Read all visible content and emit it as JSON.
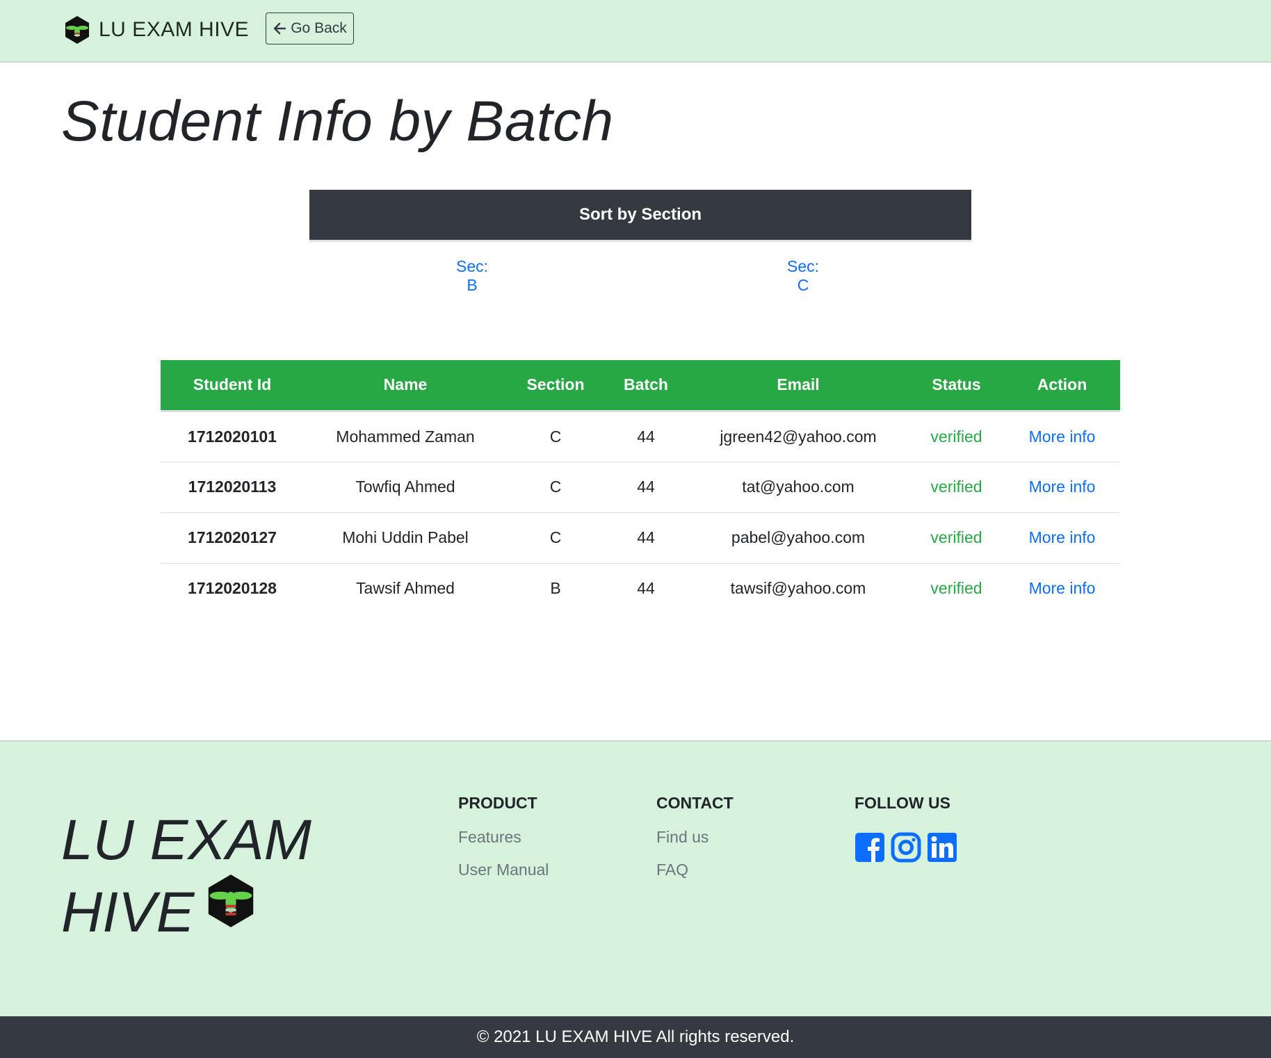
{
  "navbar": {
    "brand": "LU EXAM HIVE",
    "go_back_label": "Go Back"
  },
  "page_title": "Student Info by Batch",
  "sort": {
    "header": "Sort by Section",
    "sections": [
      "Sec: B",
      "Sec: C"
    ]
  },
  "table": {
    "columns": [
      "Student Id",
      "Name",
      "Section",
      "Batch",
      "Email",
      "Status",
      "Action"
    ],
    "rows": [
      {
        "id": "1712020101",
        "name": "Mohammed Zaman",
        "section": "C",
        "batch": "44",
        "email": "jgreen42@yahoo.com",
        "status": "verified",
        "action": "More info"
      },
      {
        "id": "1712020113",
        "name": "Towfiq Ahmed",
        "section": "C",
        "batch": "44",
        "email": "tat@yahoo.com",
        "status": "verified",
        "action": "More info"
      },
      {
        "id": "1712020127",
        "name": "Mohi Uddin Pabel",
        "section": "C",
        "batch": "44",
        "email": "pabel@yahoo.com",
        "status": "verified",
        "action": "More info"
      },
      {
        "id": "1712020128",
        "name": "Tawsif Ahmed",
        "section": "B",
        "batch": "44",
        "email": "tawsif@yahoo.com",
        "status": "verified",
        "action": "More info"
      }
    ]
  },
  "footer": {
    "brand_line1": "LU EXAM",
    "brand_line2": "HIVE",
    "product": {
      "heading": "PRODUCT",
      "links": [
        "Features",
        "User Manual"
      ]
    },
    "contact": {
      "heading": "CONTACT",
      "links": [
        "Find us",
        "FAQ"
      ]
    },
    "follow": {
      "heading": "FOLLOW US",
      "icons": [
        "facebook-icon",
        "instagram-icon",
        "linkedin-icon"
      ]
    },
    "copyright": "© 2021 LU EXAM HIVE All rights reserved."
  },
  "colors": {
    "nav_bg": "#d6f2dc",
    "table_header": "#28a745",
    "dark": "#343a40",
    "link": "#0d6efd",
    "social": "#0d6efd"
  }
}
